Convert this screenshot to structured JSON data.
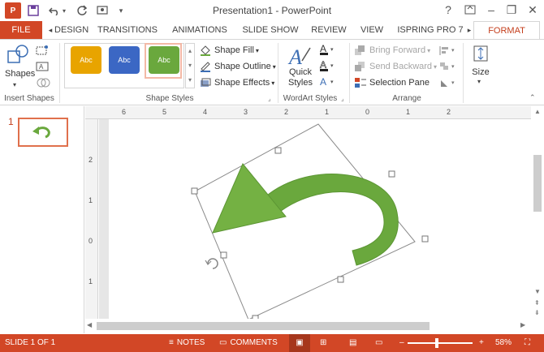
{
  "window": {
    "title": "Presentation1 - PowerPoint",
    "controls": {
      "help": "?",
      "minimize": "–",
      "restore": "❐",
      "close": "✕"
    }
  },
  "tabs": [
    {
      "label": "FILE"
    },
    {
      "label": "DESIGN"
    },
    {
      "label": "TRANSITIONS"
    },
    {
      "label": "ANIMATIONS"
    },
    {
      "label": "SLIDE SHOW"
    },
    {
      "label": "REVIEW"
    },
    {
      "label": "VIEW"
    },
    {
      "label": "ISPRING PRO 7"
    },
    {
      "label": "FORMAT"
    }
  ],
  "ribbon": {
    "insert_shapes": {
      "shapes_label": "Shapes",
      "group_label": "Insert Shapes"
    },
    "shape_styles": {
      "presets": [
        {
          "label": "Abc",
          "color": "#e8a400"
        },
        {
          "label": "Abc",
          "color": "#3b67c4"
        },
        {
          "label": "Abc",
          "color": "#6aa83d"
        }
      ],
      "fill": "Shape Fill",
      "outline": "Shape Outline",
      "effects": "Shape Effects",
      "group_label": "Shape Styles"
    },
    "wordart": {
      "quick_styles": "Quick Styles",
      "group_label": "WordArt Styles"
    },
    "arrange": {
      "bring_forward": "Bring Forward",
      "send_backward": "Send Backward",
      "selection_pane": "Selection Pane",
      "group_label": "Arrange"
    },
    "size": {
      "label": "Size"
    }
  },
  "thumbnails": [
    {
      "number": "1"
    }
  ],
  "ruler": {
    "h_ticks": [
      "6",
      "5",
      "4",
      "3",
      "2",
      "1",
      "0",
      "1",
      "2"
    ],
    "v_ticks": [
      "2",
      "1",
      "0",
      "1"
    ]
  },
  "status": {
    "slide": "SLIDE 1 OF 1",
    "notes": "NOTES",
    "comments": "COMMENTS",
    "zoom": "58%"
  },
  "colors": {
    "accent": "#d24726",
    "shape_green": "#6aa83d"
  }
}
